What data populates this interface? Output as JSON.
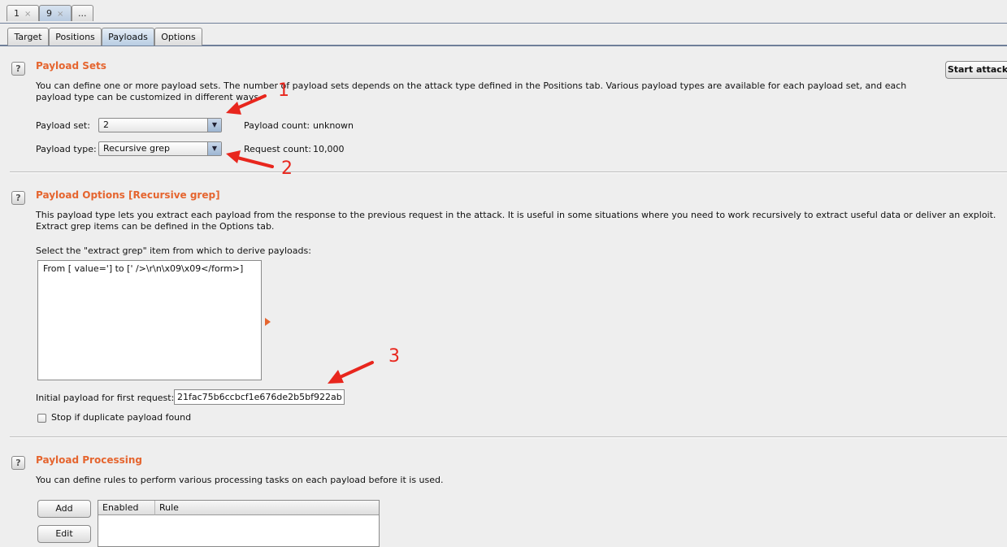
{
  "request_tabs": [
    {
      "label": "1",
      "close": "×"
    },
    {
      "label": "9",
      "close": "×"
    },
    {
      "label": "..."
    }
  ],
  "sub_tabs": [
    "Target",
    "Positions",
    "Payloads",
    "Options"
  ],
  "payload_sets": {
    "title": "Payload Sets",
    "description": "You can define one or more payload sets. The number of payload sets depends on the attack type defined in the Positions tab. Various payload types are available for each payload set, and each payload type can be customized in different ways.",
    "payload_set_label": "Payload set:",
    "payload_set_value": "2",
    "payload_type_label": "Payload type:",
    "payload_type_value": "Recursive grep",
    "payload_count_label": "Payload count:",
    "payload_count_value": "unknown",
    "request_count_label": "Request count:",
    "request_count_value": "10,000",
    "start_attack": "Start attack"
  },
  "payload_options": {
    "title": "Payload Options [Recursive grep]",
    "description": "This payload type lets you extract each payload from the response to the previous request in the attack. It is useful in some situations where you need to work recursively to extract useful data or deliver an exploit. Extract grep items can be defined in the Options tab.",
    "select_label": "Select the \"extract grep\" item from which to derive payloads:",
    "grep_items": [
      "From [ value='] to [' />\\r\\n\\x09\\x09</form>]"
    ],
    "initial_label": "Initial payload for first request:",
    "initial_value": "21fac75b6ccbcf1e676de2b5bf922ab",
    "stop_duplicate": "Stop if duplicate payload found"
  },
  "payload_processing": {
    "title": "Payload Processing",
    "description": "You can define rules to perform various processing tasks on each payload before it is used.",
    "add": "Add",
    "edit": "Edit",
    "columns": [
      "Enabled",
      "Rule"
    ]
  },
  "annotations": [
    "1",
    "2",
    "3"
  ],
  "colors": {
    "accent": "#e5652f",
    "annotation": "#e8261d",
    "tab_active": "#b8cde3"
  }
}
